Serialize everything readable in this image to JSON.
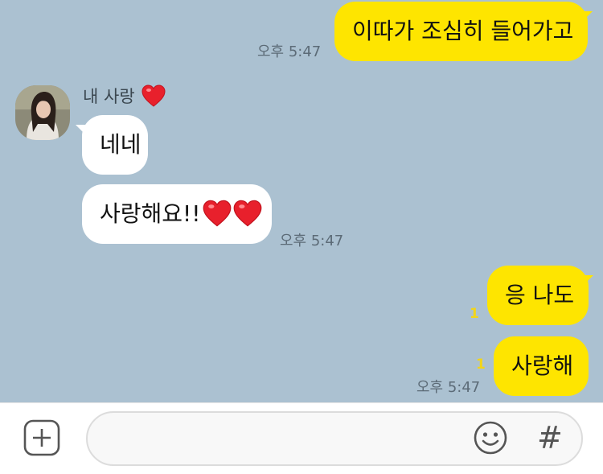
{
  "chat": {
    "sender_name": "내 사랑",
    "messages": {
      "m1": {
        "text": "이따가 조심히 들어가고",
        "time": "오후 5:47"
      },
      "m2": {
        "text": "네네"
      },
      "m3": {
        "text": "사랑해요!!",
        "time": "오후 5:47"
      },
      "m4": {
        "text": "응 나도",
        "unread": "1"
      },
      "m5": {
        "text": "사랑해",
        "unread": "1",
        "time": "오후 5:47"
      }
    }
  },
  "input": {
    "placeholder": ""
  },
  "icons": {
    "add": "plus-square-icon",
    "emoji": "smiley-icon",
    "hashtag": "hash-icon",
    "heart": "red-heart-icon"
  },
  "colors": {
    "chat_background": "#abc1d1",
    "my_bubble": "#fee500",
    "their_bubble": "#ffffff",
    "unread_count": "#f2d51a",
    "heart": "#e8202c"
  }
}
